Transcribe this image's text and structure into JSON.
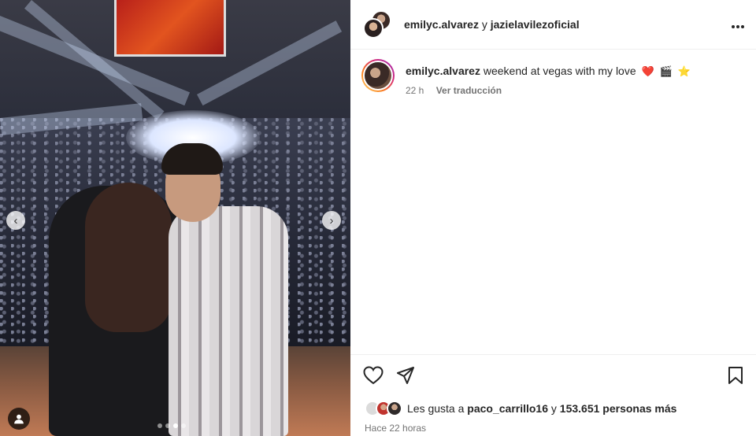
{
  "post": {
    "collab_users": [
      "emilyc.alvarez",
      "jazielavilezoficial"
    ],
    "collab_conjunction": "y",
    "caption_user": "emilyc.alvarez",
    "caption_text": "weekend at vegas with my love",
    "caption_emojis": [
      "❤️",
      "🎬",
      "⭐"
    ],
    "caption_time": "22 h",
    "translate_label": "Ver traducción",
    "likes_prefix": "Les gusta a",
    "liked_by": "paco_carrillo16",
    "likes_conjunction": "y",
    "likes_count_text": "153.651 personas más",
    "posted_ago": "Hace 22 horas"
  },
  "carousel": {
    "prev_label": "‹",
    "next_label": "›",
    "total_slides": 4,
    "active_slide": 3
  },
  "icons": {
    "more": "more-options-icon",
    "like": "heart-icon",
    "share": "send-icon",
    "save": "bookmark-icon",
    "tag": "user-tag-icon"
  },
  "colors": {
    "text": "#262626",
    "secondary": "#737373",
    "divider": "#efefef"
  }
}
